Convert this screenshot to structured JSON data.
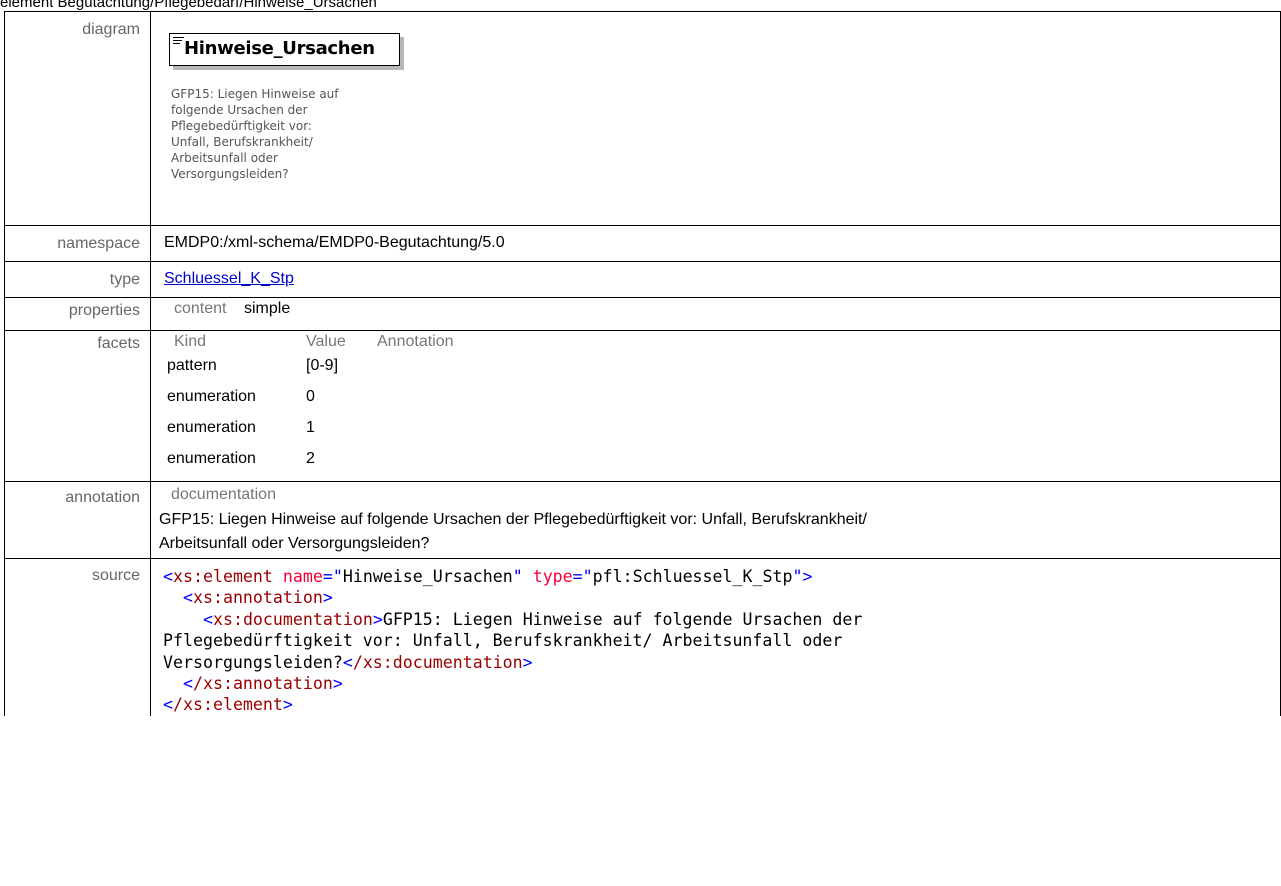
{
  "header_text": "element Begutachtung/Pflegebedarf/Hinweise_Ursachen",
  "labels": {
    "diagram": "diagram",
    "namespace": "namespace",
    "type": "type",
    "properties": "properties",
    "facets": "facets",
    "annotation": "annotation",
    "source": "source"
  },
  "diagram": {
    "element_name": "Hinweise_Ursachen",
    "doc_text": "GFP15: Liegen Hinweise auf\nfolgende Ursachen der\nPflegebedürftigkeit vor:\nUnfall, Berufskrankheit/\nArbeitsunfall oder\nVersorgungsleiden?"
  },
  "namespace_value": "EMDP0:/xml-schema/EMDP0-Begutachtung/5.0",
  "type_value": "Schluessel_K_Stp",
  "properties": {
    "key": "content",
    "value": "simple"
  },
  "facets": {
    "headers": [
      "Kind",
      "Value",
      "Annotation"
    ],
    "rows": [
      {
        "kind": "pattern",
        "value": "[0-9]"
      },
      {
        "kind": "enumeration",
        "value": "0"
      },
      {
        "kind": "enumeration",
        "value": "1"
      },
      {
        "kind": "enumeration",
        "value": "2"
      }
    ]
  },
  "annotation": {
    "header": "documentation",
    "text_line1": "GFP15: Liegen Hinweise auf folgende Ursachen der Pflegebedürftigkeit vor: Unfall, Berufskrankheit/",
    "text_line2": "Arbeitsunfall oder Versorgungsleiden?"
  },
  "source": {
    "open_tag": "xs:element",
    "attr_name": "name",
    "attr_name_value": "Hinweise_Ursachen",
    "attr_type": "type",
    "attr_type_value": "pfl:Schluessel_K_Stp",
    "annotation_tag": "xs:annotation",
    "documentation_tag": "xs:documentation",
    "doc_line1": "GFP15: Liegen Hinweise auf folgende Ursachen der",
    "doc_line2": "Pflegebedürftigkeit vor: Unfall, Berufskrankheit/ Arbeitsunfall oder",
    "doc_line3": "Versorgungsleiden?",
    "close_documentation": "/xs:documentation",
    "close_annotation": "/xs:annotation",
    "close_element": "/xs:element"
  }
}
